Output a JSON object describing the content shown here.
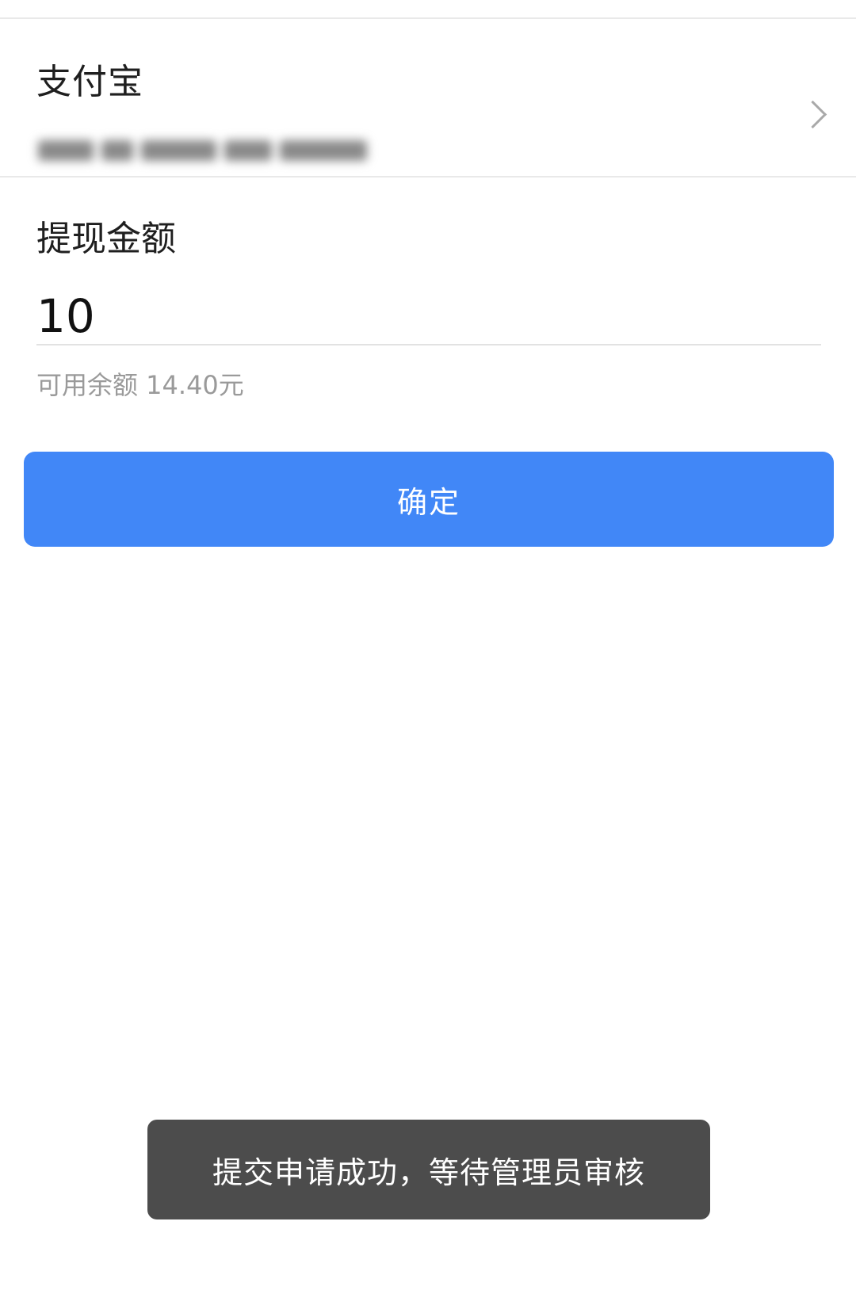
{
  "account": {
    "title": "支付宝"
  },
  "withdraw": {
    "label": "提现金额",
    "amount": "10",
    "balance_text": "可用余额 14.40元"
  },
  "confirm_button": {
    "label": "确定"
  },
  "toast": {
    "message": "提交申请成功，等待管理员审核"
  },
  "colors": {
    "primary": "#4187f7",
    "toast_bg": "#4c4c4c",
    "muted_text": "#9a9a9a"
  },
  "icons": {
    "account_row_arrow": "chevron-right-icon"
  }
}
